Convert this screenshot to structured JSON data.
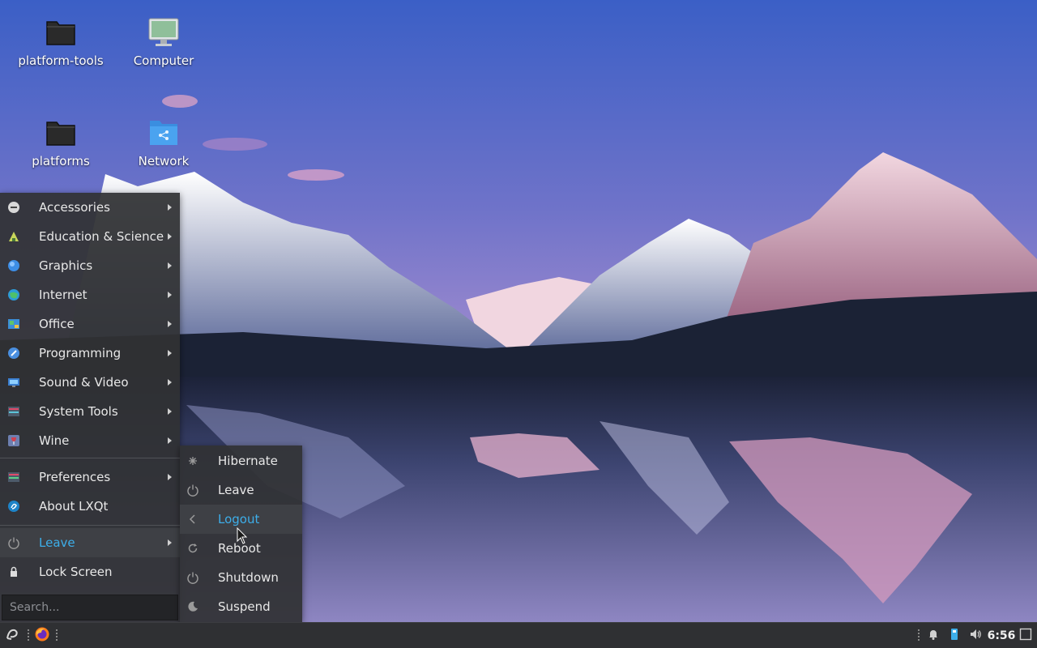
{
  "desktop": {
    "icons": [
      {
        "label": "platform-tools",
        "icon": "folder-icon"
      },
      {
        "label": "Computer",
        "icon": "computer-icon"
      },
      {
        "label": "platforms",
        "icon": "folder-icon"
      },
      {
        "label": "Network",
        "icon": "network-folder-icon"
      }
    ]
  },
  "main_menu": {
    "items": [
      {
        "label": "Accessories",
        "icon": "accessories-icon",
        "has_submenu": true
      },
      {
        "label": "Education & Science",
        "icon": "education-icon",
        "has_submenu": true
      },
      {
        "label": "Graphics",
        "icon": "graphics-icon",
        "has_submenu": true
      },
      {
        "label": "Internet",
        "icon": "internet-globe-icon",
        "has_submenu": true
      },
      {
        "label": "Office",
        "icon": "office-icon",
        "has_submenu": true
      },
      {
        "label": "Programming",
        "icon": "programming-icon",
        "has_submenu": true
      },
      {
        "label": "Sound & Video",
        "icon": "sound-video-icon",
        "has_submenu": true
      },
      {
        "label": "System Tools",
        "icon": "system-tools-icon",
        "has_submenu": true
      },
      {
        "label": "Wine",
        "icon": "wine-icon",
        "has_submenu": true
      },
      {
        "label": "Preferences",
        "icon": "preferences-icon",
        "has_submenu": true
      },
      {
        "label": "About LXQt",
        "icon": "lxqt-icon",
        "has_submenu": false
      },
      {
        "label": "Leave",
        "icon": "power-icon",
        "has_submenu": true,
        "active": true
      },
      {
        "label": "Lock Screen",
        "icon": "lock-icon",
        "has_submenu": false
      }
    ],
    "search_placeholder": "Search..."
  },
  "leave_submenu": {
    "items": [
      {
        "label": "Hibernate",
        "icon": "hibernate-icon"
      },
      {
        "label": "Leave",
        "icon": "power-icon"
      },
      {
        "label": "Logout",
        "icon": "logout-arrow-icon",
        "hovered": true
      },
      {
        "label": "Reboot",
        "icon": "reboot-icon"
      },
      {
        "label": "Shutdown",
        "icon": "shutdown-icon"
      },
      {
        "label": "Suspend",
        "icon": "suspend-moon-icon"
      }
    ]
  },
  "taskbar": {
    "clock": "6:56",
    "tray_icons": [
      "bell-icon",
      "usb-icon",
      "volume-icon",
      "show-desktop-icon"
    ]
  },
  "colors": {
    "accent": "#3daee9",
    "menu_bg": "#303134",
    "taskbar_bg": "#2f3033"
  }
}
